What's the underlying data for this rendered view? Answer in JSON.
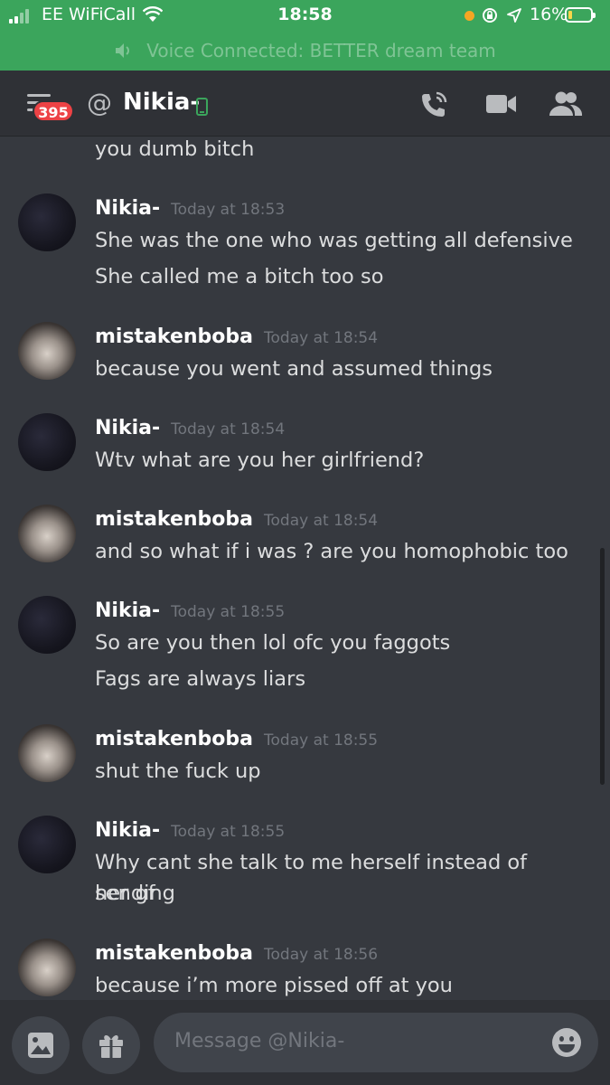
{
  "status_bar": {
    "carrier": "EE WiFiCall",
    "time": "18:58",
    "battery_percent": "16%",
    "battery_level": 0.16
  },
  "voice_banner": {
    "text": "Voice Connected: BETTER dream team"
  },
  "header": {
    "unread_badge": "395",
    "at_symbol": "@",
    "title": "Nikia-",
    "icons": [
      "menu-icon",
      "mobile-phone-icon",
      "call-icon",
      "video-icon",
      "members-icon"
    ]
  },
  "messages": [
    {
      "continuation": true,
      "lines": [
        "you dumb bitch"
      ]
    },
    {
      "author": "Nikia-",
      "avatar": "nikia",
      "timestamp": "Today at 18:53",
      "lines": [
        "She was the one who was getting all defensive",
        "She called me a bitch too so"
      ]
    },
    {
      "author": "mistakenboba",
      "avatar": "boba",
      "timestamp": "Today at 18:54",
      "lines": [
        "because you went and assumed things"
      ]
    },
    {
      "author": "Nikia-",
      "avatar": "nikia",
      "timestamp": "Today at 18:54",
      "lines": [
        "Wtv what are you her girlfriend?"
      ]
    },
    {
      "author": "mistakenboba",
      "avatar": "boba",
      "timestamp": "Today at 18:54",
      "lines": [
        "and so what if i was ? are you homophobic too"
      ]
    },
    {
      "author": "Nikia-",
      "avatar": "nikia",
      "timestamp": "Today at 18:55",
      "lines": [
        "So are you then lol ofc you faggots",
        "Fags are always liars"
      ]
    },
    {
      "author": "mistakenboba",
      "avatar": "boba",
      "timestamp": "Today at 18:55",
      "lines": [
        "shut the fuck up"
      ]
    },
    {
      "author": "Nikia-",
      "avatar": "nikia",
      "timestamp": "Today at 18:55",
      "lines": [
        "Why cant she talk to me herself instead of sending",
        "her gf"
      ]
    },
    {
      "author": "mistakenboba",
      "avatar": "boba",
      "timestamp": "Today at 18:56",
      "lines": [
        "because i’m more pissed off at you"
      ]
    }
  ],
  "composer": {
    "placeholder": "Message @Nikia-",
    "icons": [
      "image-icon",
      "gift-icon",
      "emoji-icon"
    ]
  },
  "colors": {
    "status_green": "#3ba55c",
    "background": "#36393f",
    "header": "#2f3136",
    "badge_red": "#ed4245",
    "mobile_green": "#3ba55c"
  }
}
